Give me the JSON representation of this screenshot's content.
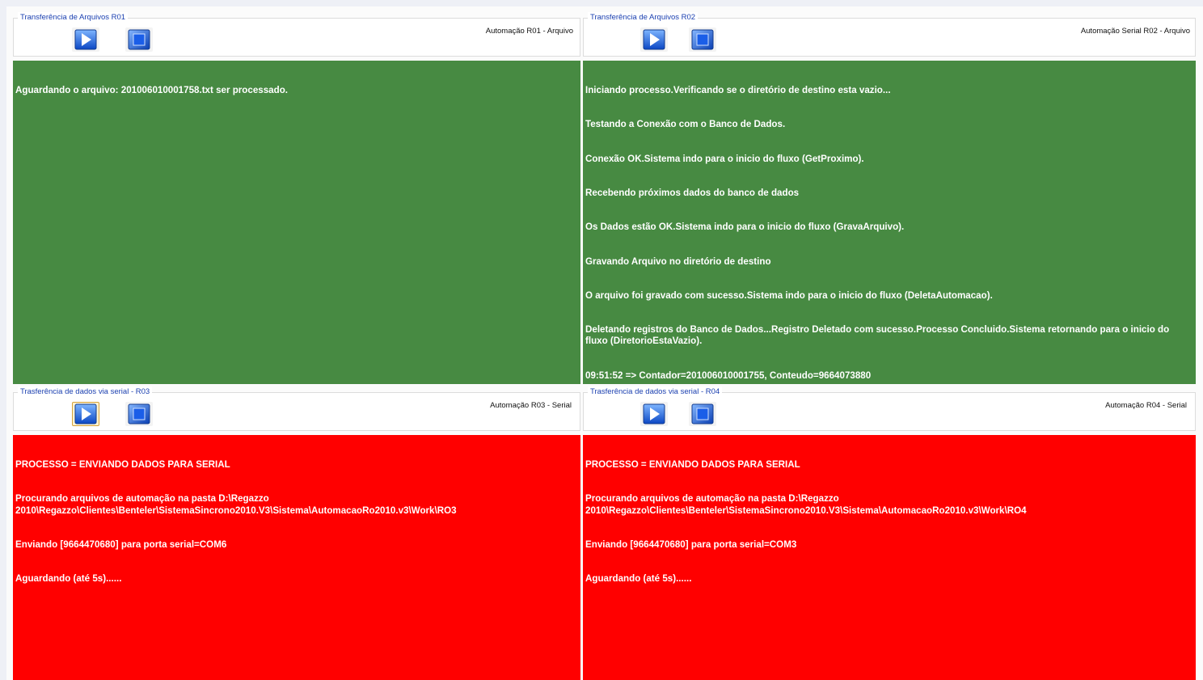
{
  "panels": [
    {
      "id": "ro1",
      "group_title": "Transferência de Arquivos R01",
      "description": "Automação R01 - Arquivo",
      "play_label": "Iniciar",
      "stop_label": "Parar",
      "log_color": "#478a42",
      "log_lines": [
        "Aguardando o arquivo: 201006010001758.txt ser processado."
      ]
    },
    {
      "id": "ro2",
      "group_title": "Transferência de Arquivos R02",
      "description": "Automação Serial  R02 - Arquivo",
      "play_label": "Iniciar",
      "stop_label": "Parar",
      "log_color": "#478a42",
      "log_lines": [
        "Iniciando processo.Verificando se o diretório de destino esta vazio...",
        "Testando a Conexão com o Banco de Dados.",
        "Conexão OK.Sistema indo para o inicio do fluxo (GetProximo).",
        "Recebendo próximos dados do banco de dados",
        "Os Dados estão OK.Sistema indo para o inicio do fluxo (GravaArquivo).",
        "Gravando Arquivo no diretório de destino",
        "O arquivo foi gravado com sucesso.Sistema indo para o inicio do fluxo (DeletaAutomacao).",
        "Deletando registros do Banco de Dados...Registro Deletado com sucesso.Processo Concluido.Sistema retornando para o inicio do fluxo (DiretorioEstaVazio).",
        "09:51:52 => Contador=201006010001755, Conteudo=9664073880"
      ]
    },
    {
      "id": "ro3",
      "group_title": "Trasferência de dados via serial - R03",
      "description": "Automação R03 - Serial",
      "play_label": "Iniciar",
      "stop_label": "Parar",
      "log_color": "#ff0000",
      "log_lines": [
        "PROCESSO = ENVIANDO DADOS PARA SERIAL",
        "Procurando arquivos de automação na pasta D:\\Regazzo 2010\\Regazzo\\Clientes\\Benteler\\SistemaSincrono2010.V3\\Sistema\\AutomacaoRo2010.v3\\Work\\RO3",
        "Enviando [9664470680] para porta serial=COM6",
        "Aguardando (até 5s)......"
      ]
    },
    {
      "id": "ro4",
      "group_title": "Trasferência de dados via serial - R04",
      "description": "Automação R04 - Serial",
      "play_label": "Iniciar",
      "stop_label": "Parar",
      "log_color": "#ff0000",
      "log_lines": [
        "PROCESSO = ENVIANDO DADOS PARA SERIAL",
        "Procurando arquivos de automação na pasta D:\\Regazzo 2010\\Regazzo\\Clientes\\Benteler\\SistemaSincrono2010.V3\\Sistema\\AutomacaoRo2010.v3\\Work\\RO4",
        "Enviando [9664470680] para porta serial=COM3",
        "Aguardando (até 5s)......"
      ]
    }
  ]
}
